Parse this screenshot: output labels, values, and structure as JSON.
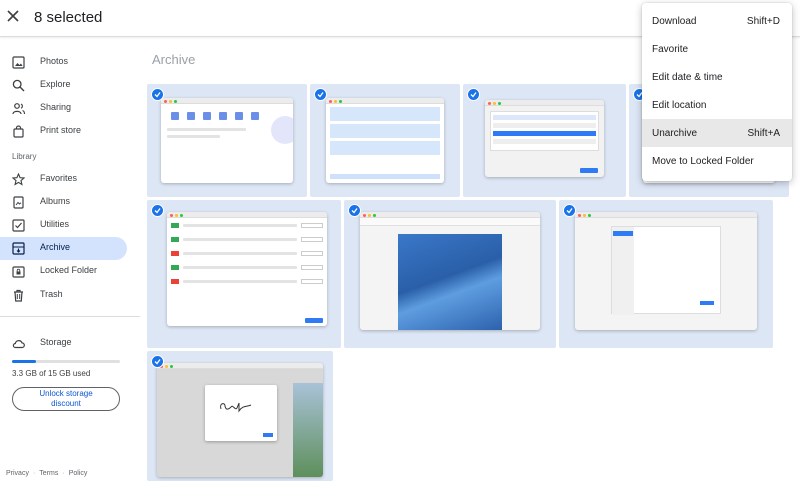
{
  "header": {
    "selected_text": "8 selected"
  },
  "sidebar": {
    "items": [
      {
        "label": "Photos",
        "icon": "photo-icon"
      },
      {
        "label": "Explore",
        "icon": "search-icon"
      },
      {
        "label": "Sharing",
        "icon": "people-icon"
      },
      {
        "label": "Print store",
        "icon": "shopping-bag-icon"
      }
    ],
    "library_label": "Library",
    "library_items": [
      {
        "label": "Favorites",
        "icon": "star-icon"
      },
      {
        "label": "Albums",
        "icon": "album-icon"
      },
      {
        "label": "Utilities",
        "icon": "utilities-icon"
      },
      {
        "label": "Archive",
        "icon": "archive-icon",
        "active": true
      },
      {
        "label": "Locked Folder",
        "icon": "lock-icon"
      },
      {
        "label": "Trash",
        "icon": "trash-icon"
      }
    ],
    "storage": {
      "label": "Storage",
      "usage_text": "3.3 GB of 15 GB used",
      "used_fraction": 0.22,
      "unlock_label": "Unlock storage discount"
    },
    "footer": [
      "Privacy",
      "Terms",
      "Policy"
    ]
  },
  "main": {
    "section_title": "Archive"
  },
  "menu": {
    "items": [
      {
        "label": "Download",
        "shortcut": "Shift+D"
      },
      {
        "label": "Favorite",
        "shortcut": ""
      },
      {
        "label": "Edit date & time",
        "shortcut": ""
      },
      {
        "label": "Edit location",
        "shortcut": ""
      },
      {
        "label": "Unarchive",
        "shortcut": "Shift+A",
        "hover": true
      },
      {
        "label": "Move to Locked Folder",
        "shortcut": ""
      }
    ]
  },
  "colors": {
    "accent": "#1a73e8",
    "active_nav": "#d3e3fd",
    "tile_bg": "#dde6f5"
  }
}
